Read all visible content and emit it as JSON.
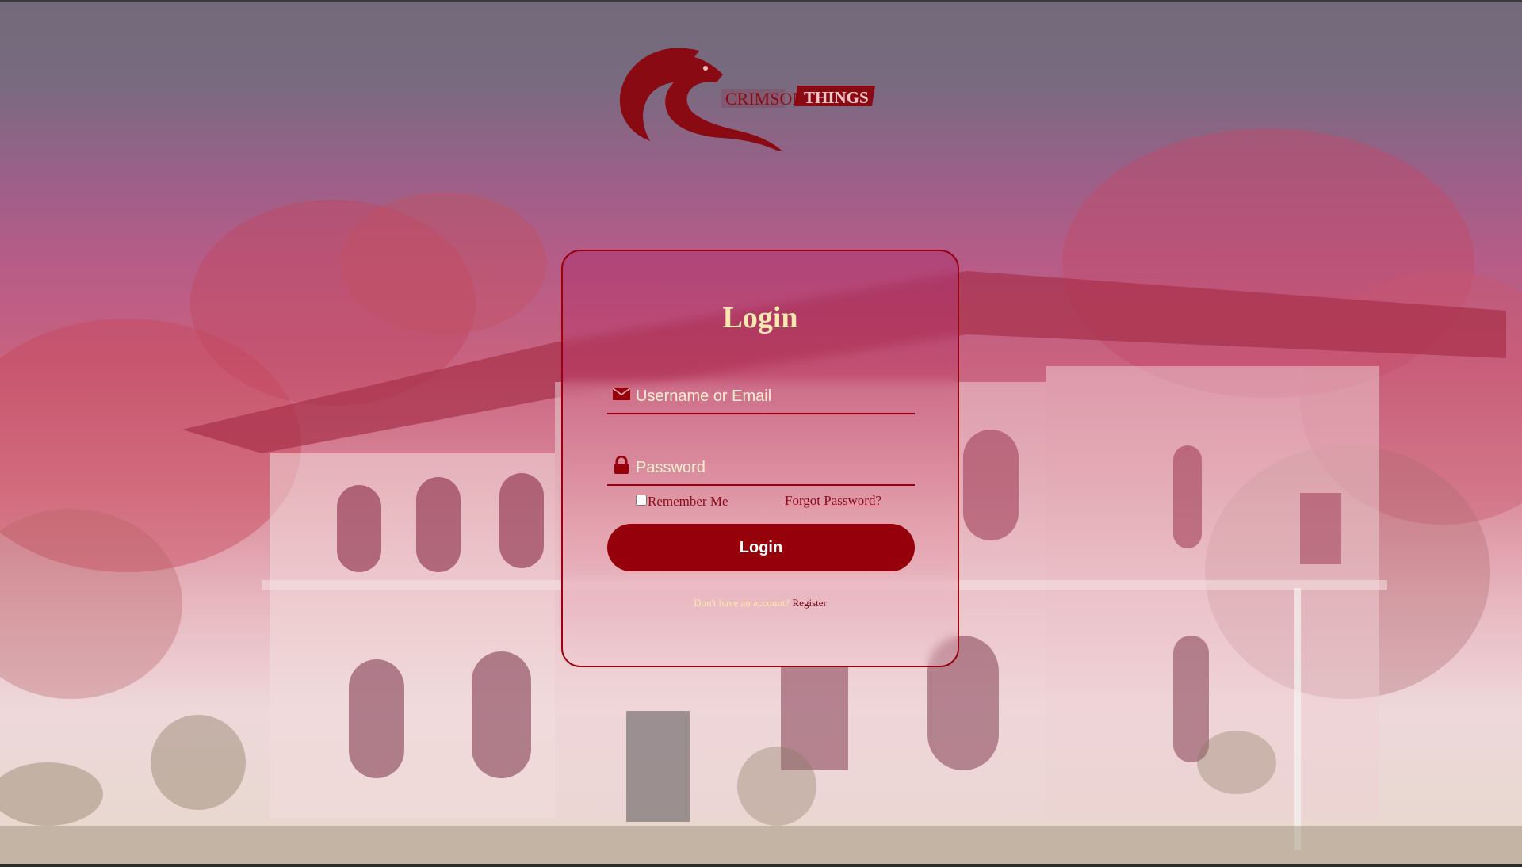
{
  "logo": {
    "text_left": "CRIMSON",
    "text_right": "THINGS"
  },
  "login_card": {
    "title": "Login",
    "username_placeholder": "Username or Email",
    "password_placeholder": "Password",
    "remember_label": "Remember Me",
    "forgot_label": "Forgot Password?",
    "login_button_label": "Login",
    "no_account_text": "Don't have an account?",
    "register_link": "Register"
  },
  "icons": {
    "username": "envelope-icon",
    "password": "lock-icon",
    "logo": "eagle-icon"
  },
  "colors": {
    "accent": "#96000a",
    "title": "#fde8b0",
    "link": "#8a0a1a"
  }
}
